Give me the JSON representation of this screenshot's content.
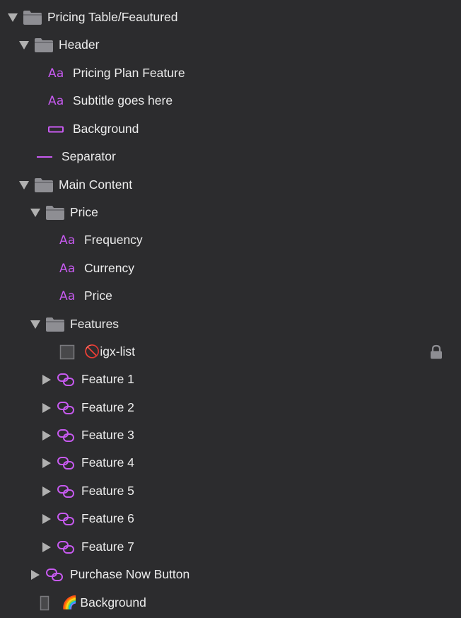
{
  "layers": [
    {
      "label": "Pricing Table/Feautured",
      "icon": "folder-icon",
      "disclosure": "expanded"
    },
    {
      "label": "Header",
      "icon": "folder-icon",
      "disclosure": "expanded"
    },
    {
      "label": "Pricing Plan Feature",
      "icon": "text-layer-icon",
      "icon_text": "Aa"
    },
    {
      "label": "Subtitle goes here",
      "icon": "text-layer-icon",
      "icon_text": "Aa"
    },
    {
      "label": "Background",
      "icon": "rectangle-icon"
    },
    {
      "label": "Separator",
      "icon": "line-icon"
    },
    {
      "label": "Main Content",
      "icon": "folder-icon",
      "disclosure": "expanded"
    },
    {
      "label": "Price",
      "icon": "folder-icon",
      "disclosure": "expanded"
    },
    {
      "label": "Frequency",
      "icon": "text-layer-icon",
      "icon_text": "Aa"
    },
    {
      "label": "Currency",
      "icon": "text-layer-icon",
      "icon_text": "Aa"
    },
    {
      "label": "Price",
      "icon": "text-layer-icon",
      "icon_text": "Aa"
    },
    {
      "label": "Features",
      "icon": "folder-icon",
      "disclosure": "expanded"
    },
    {
      "label": "igx-list",
      "icon": "hidden-layer-icon",
      "prefix_emoji": "🚫",
      "locked": true
    },
    {
      "label": "Feature 1",
      "icon": "symbol-instance-icon",
      "disclosure": "collapsed"
    },
    {
      "label": "Feature 2",
      "icon": "symbol-instance-icon",
      "disclosure": "collapsed"
    },
    {
      "label": "Feature 3",
      "icon": "symbol-instance-icon",
      "disclosure": "collapsed"
    },
    {
      "label": "Feature 4",
      "icon": "symbol-instance-icon",
      "disclosure": "collapsed"
    },
    {
      "label": "Feature 5",
      "icon": "symbol-instance-icon",
      "disclosure": "collapsed"
    },
    {
      "label": "Feature 6",
      "icon": "symbol-instance-icon",
      "disclosure": "collapsed"
    },
    {
      "label": "Feature 7",
      "icon": "symbol-instance-icon",
      "disclosure": "collapsed"
    },
    {
      "label": "Purchase Now Button",
      "icon": "symbol-instance-icon",
      "disclosure": "collapsed"
    },
    {
      "label": "Background",
      "icon": "artboard-background-icon",
      "prefix_emoji": "🌈"
    }
  ],
  "colors": {
    "background": "#2c2c2e",
    "accent": "#c75af0",
    "text": "#ececec",
    "folder": "#8e8e93",
    "disclosure": "#b0b0b0"
  }
}
